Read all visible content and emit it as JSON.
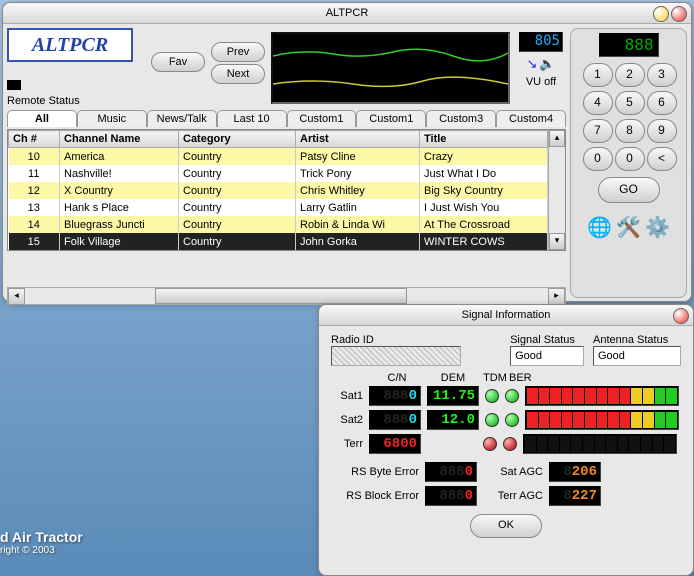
{
  "main": {
    "title": "ALTPCR",
    "logo": "ALTPCR",
    "remote_label": "Remote Status",
    "fav": "Fav",
    "prev": "Prev",
    "next": "Next",
    "vu_value": "805",
    "vu_off": "VU off",
    "tabs": [
      "All",
      "Music",
      "News/Talk",
      "Last 10",
      "Custom1",
      "Custom1",
      "Custom3",
      "Custom4"
    ],
    "headers": {
      "ch": "Ch #",
      "name": "Channel Name",
      "cat": "Category",
      "artist": "Artist",
      "title": "Title"
    },
    "rows": [
      {
        "ch": "10",
        "name": "America",
        "cat": "Country",
        "artist": "Patsy Cline",
        "title": "Crazy",
        "cls": "y"
      },
      {
        "ch": "11",
        "name": "Nashville!",
        "cat": "Country",
        "artist": "Trick Pony",
        "title": "Just What I Do",
        "cls": "w"
      },
      {
        "ch": "12",
        "name": "X Country",
        "cat": "Country",
        "artist": "Chris Whitley",
        "title": "Big Sky Country",
        "cls": "y"
      },
      {
        "ch": "13",
        "name": "Hank s Place",
        "cat": "Country",
        "artist": "Larry Gatlin",
        "title": "I Just Wish You",
        "cls": "w"
      },
      {
        "ch": "14",
        "name": "Bluegrass Juncti",
        "cat": "Country",
        "artist": "Robin & Linda Wi",
        "title": "At The Crossroad",
        "cls": "y"
      },
      {
        "ch": "15",
        "name": "Folk Village",
        "cat": "Country",
        "artist": "John Gorka",
        "title": "WINTER COWS",
        "cls": "sel"
      }
    ],
    "keypad": [
      "1",
      "2",
      "3",
      "4",
      "5",
      "6",
      "7",
      "8",
      "9",
      "0",
      "0",
      "<"
    ],
    "r_lcd": "888",
    "go": "GO"
  },
  "signal": {
    "title": "Signal Information",
    "radio_id_lbl": "Radio ID",
    "sig_status_lbl": "Signal Status",
    "ant_status_lbl": "Antenna Status",
    "sig_status": "Good",
    "ant_status": "Good",
    "col_cn": "C/N",
    "col_dem": "DEM",
    "col_tdm": "TDM",
    "col_ber": "BER",
    "sat1_lbl": "Sat1",
    "sat2_lbl": "Sat2",
    "terr_lbl": "Terr",
    "sat1_cn_dim": "888",
    "sat1_cn_val": "0",
    "sat1_dem": "11.75",
    "sat2_cn_dim": "888",
    "sat2_cn_val": "0",
    "sat2_dem": "12.0",
    "terr_cn": "6800",
    "rs_byte_lbl": "RS Byte Error",
    "rs_block_lbl": "RS Block Error",
    "rs_byte_dim": "888",
    "rs_byte_val": "0",
    "rs_block_dim": "888",
    "rs_block_val": "0",
    "sat_agc_lbl": "Sat AGC",
    "terr_agc_lbl": "Terr AGC",
    "sat_agc_dim": "8",
    "sat_agc_val": "206",
    "terr_agc_dim": "8",
    "terr_agc_val": "227",
    "ok": "OK"
  },
  "desktop": {
    "text1": "d Air Tractor",
    "text2": "right © 2003"
  }
}
